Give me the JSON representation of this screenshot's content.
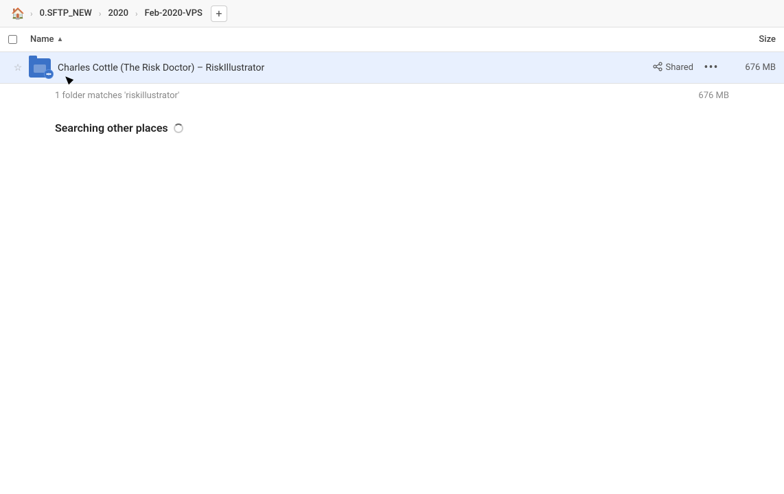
{
  "breadcrumb": {
    "home_icon": "🏠",
    "items": [
      {
        "label": "0.SFTP_NEW"
      },
      {
        "label": "2020"
      },
      {
        "label": "Feb-2020-VPS"
      }
    ],
    "add_label": "+"
  },
  "column_header": {
    "name_label": "Name",
    "sort_arrow": "▲",
    "size_label": "Size"
  },
  "file_row": {
    "name": "Charles Cottle (The Risk Doctor) – RiskIllustrator",
    "shared_label": "Shared",
    "more_icon": "•••",
    "size": "676 MB"
  },
  "summary": {
    "matches_text": "1 folder matches 'riskillustrator'",
    "size": "676 MB"
  },
  "searching": {
    "title": "Searching other places"
  }
}
